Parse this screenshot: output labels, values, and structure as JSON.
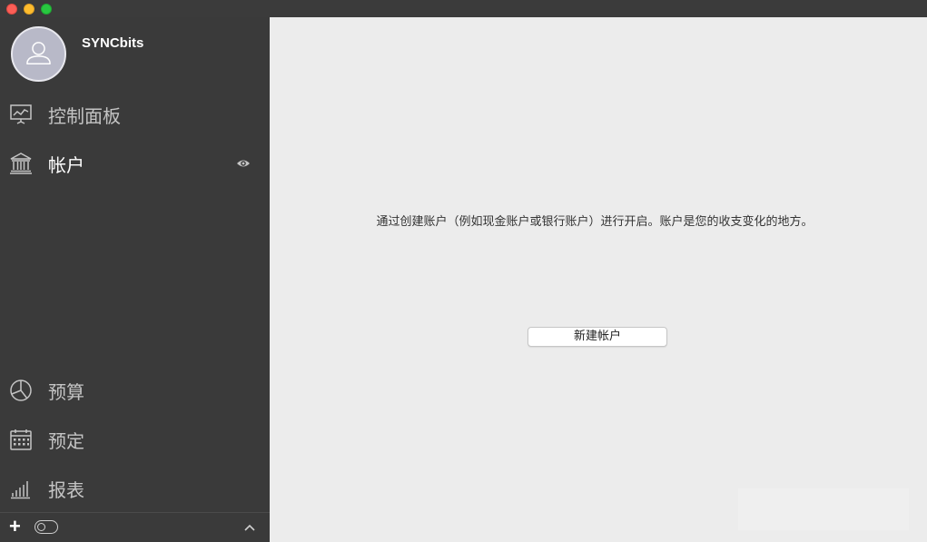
{
  "window": {
    "controls": [
      "close",
      "minimize",
      "maximize"
    ]
  },
  "sidebar": {
    "username": "SYNCbits",
    "nav": [
      {
        "label": "控制面板",
        "icon": "dashboard-icon"
      },
      {
        "label": "帐户",
        "icon": "bank-icon",
        "active": true
      },
      {
        "label": "预算",
        "icon": "pie-chart-icon"
      },
      {
        "label": "预定",
        "icon": "calendar-icon"
      },
      {
        "label": "报表",
        "icon": "bar-chart-icon"
      }
    ],
    "footer": {
      "add_label": "+"
    }
  },
  "main": {
    "message": "通过创建账户（例如现金账户或银行账户）进行开启。账户是您的收支变化的地方。",
    "new_account_button": "新建帐户"
  },
  "colors": {
    "sidebar_bg": "#3a3a3a",
    "main_bg": "#ececec",
    "active_text": "#ffffff",
    "inactive_text": "#c4c4c4"
  }
}
